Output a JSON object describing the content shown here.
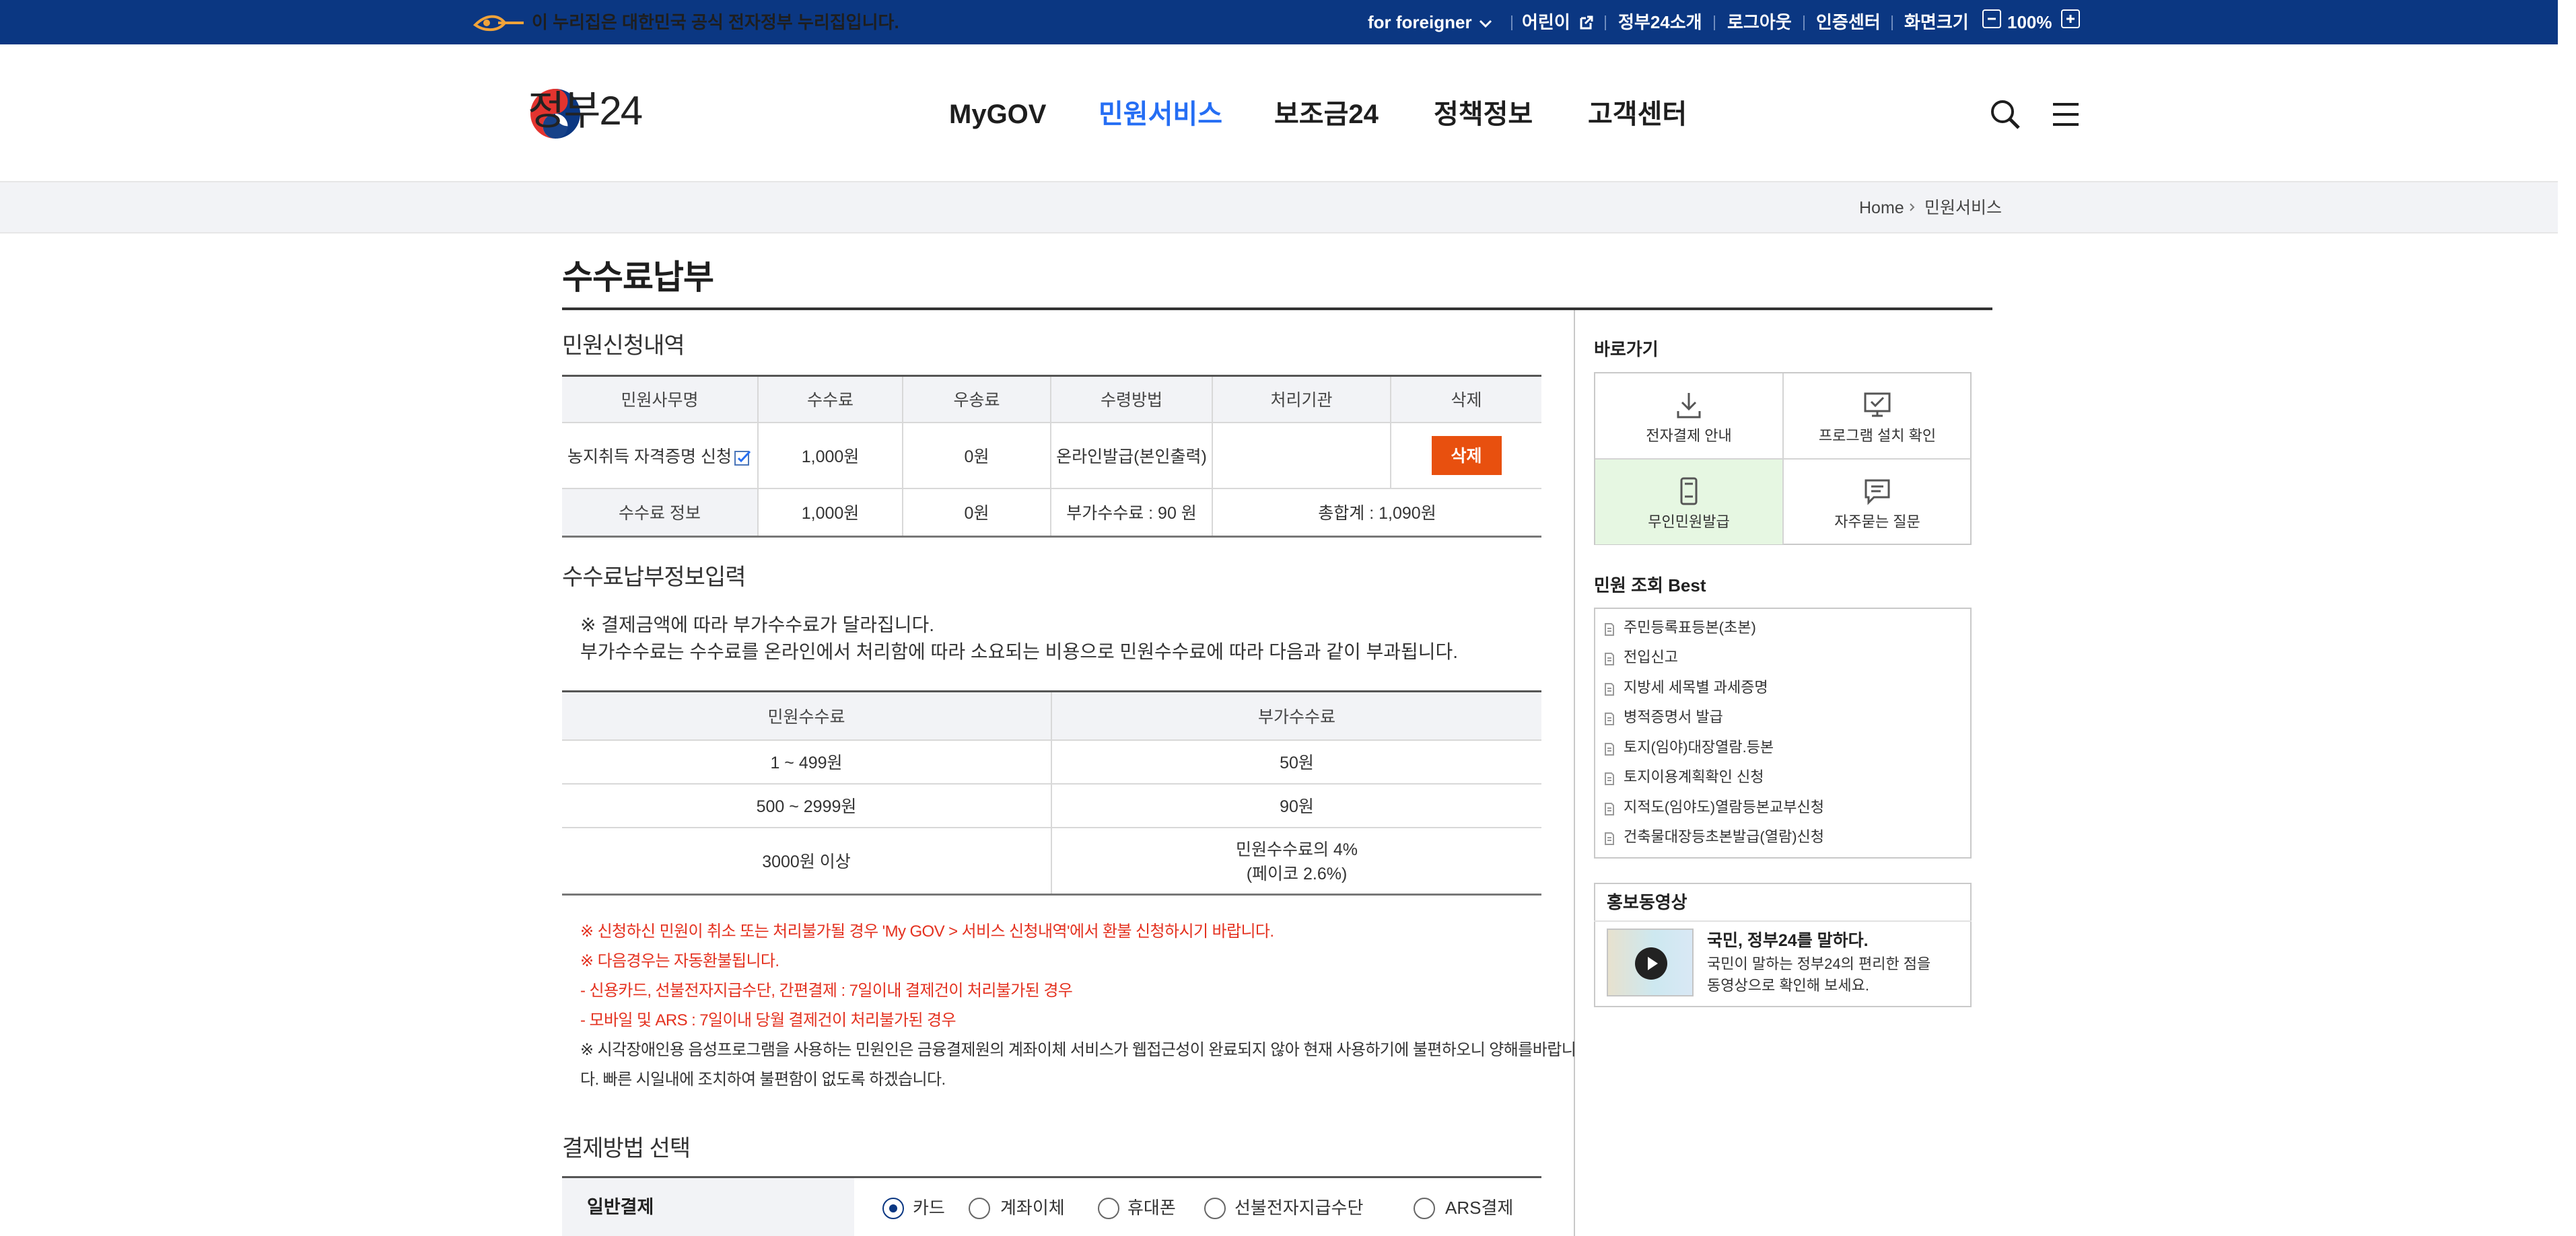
{
  "topbar": {
    "notice": "이 누리집은 대한민국 공식 전자정부 누리집입니다.",
    "foreigner": "for foreigner",
    "kids": "어린이",
    "about": "정부24소개",
    "logout": "로그아웃",
    "cert": "인증센터",
    "screen_size": "화면크기",
    "zoom": "100%",
    "colors": {
      "bar": "#0b3782",
      "accent": "#256ef4",
      "button": "#e8500f",
      "warning": "#e4311f"
    }
  },
  "header": {
    "logo_text": "정부24",
    "nav": [
      "MyGOV",
      "민원서비스",
      "보조금24",
      "정책정보",
      "고객센터"
    ],
    "active_nav": "민원서비스",
    "icons": [
      "search-icon",
      "menu-icon"
    ]
  },
  "breadcrumb": [
    "Home",
    "민원서비스"
  ],
  "main": {
    "title": "수수료납부",
    "application": {
      "title": "민원신청내역",
      "headers": [
        "민원사무명",
        "수수료",
        "우송료",
        "수령방법",
        "처리기관",
        "삭제"
      ],
      "row": {
        "name": "농지취득 자격증명 신청",
        "fee": "1,000원",
        "postage": "0원",
        "receive": "온라인발급(본인출력)",
        "office": "",
        "delete": "삭제"
      },
      "info": {
        "label": "수수료 정보",
        "fee": "1,000원",
        "postage": "0원",
        "additional": "부가수수료 : 90 원",
        "total": "총합계 : 1,090원"
      }
    },
    "fee_info": {
      "title": "수수료납부정보입력",
      "lines": [
        "※ 결제금액에 따라 부가수수료가 달라집니다.",
        "부가수수료는 수수료를 온라인에서 처리함에 따라 소요되는 비용으로 민원수수료에 따라 다음과 같이 부과됩니다."
      ],
      "headers": [
        "민원수수료",
        "부가수수료"
      ],
      "rows": [
        {
          "base": "1 ~ 499원",
          "extra": "50원",
          "extra2": ""
        },
        {
          "base": "500 ~ 2999원",
          "extra": "90원",
          "extra2": ""
        },
        {
          "base": "3000원 이상",
          "extra": "민원수수료의 4%",
          "extra2": "(페이코 2.6%)"
        }
      ]
    },
    "notices": [
      "※ 신청하신 민원이 취소 또는 처리불가될 경우 'My GOV > 서비스 신청내역'에서 환불 신청하시기 바랍니다.",
      "※ 다음경우는 자동환불됩니다.",
      "- 신용카드, 선불전자지급수단, 간편결제 : 7일이내 결제건이 처리불가된 경우",
      "- 모바일 및 ARS : 7일이내 당월 결제건이 처리불가된 경우",
      "※ 시각장애인용 음성프로그램을 사용하는 민원인은 금융결제원의 계좌이체 서비스가 웹접근성이 완료되지 않아 현재 사용하기에 불편하오니 양해를바랍니",
      "다. 빠른 시일내에 조치하여 불편함이 없도록 하겠습니다."
    ],
    "payment": {
      "title": "결제방법 선택",
      "label": "일반결제",
      "options": [
        "카드",
        "계좌이체",
        "휴대폰",
        "선불전자지급수단",
        "ARS결제"
      ],
      "selected": "카드"
    }
  },
  "sidebar": {
    "quick_title": "바로가기",
    "quick": [
      {
        "label": "전자결제 안내",
        "icon": "download-icon"
      },
      {
        "label": "프로그램 설치 확인",
        "icon": "monitor-check-icon"
      },
      {
        "label": "무인민원발급",
        "icon": "kiosk-icon"
      },
      {
        "label": "자주묻는 질문",
        "icon": "chat-icon"
      }
    ],
    "best_title": "민원 조회 Best",
    "best": [
      "주민등록표등본(초본)",
      "전입신고",
      "지방세 세목별 과세증명",
      "병적증명서 발급",
      "토지(임야)대장열람.등본",
      "토지이용계획확인 신청",
      "지적도(임야도)열람등본교부신청",
      "건축물대장등초본발급(열람)신청"
    ],
    "video_title": "홍보동영상",
    "video": {
      "headline": "국민, 정부24를 말하다.",
      "desc1": "국민이 말하는 정부24의 편리한 점을",
      "desc2": "동영상으로 확인해 보세요."
    }
  }
}
